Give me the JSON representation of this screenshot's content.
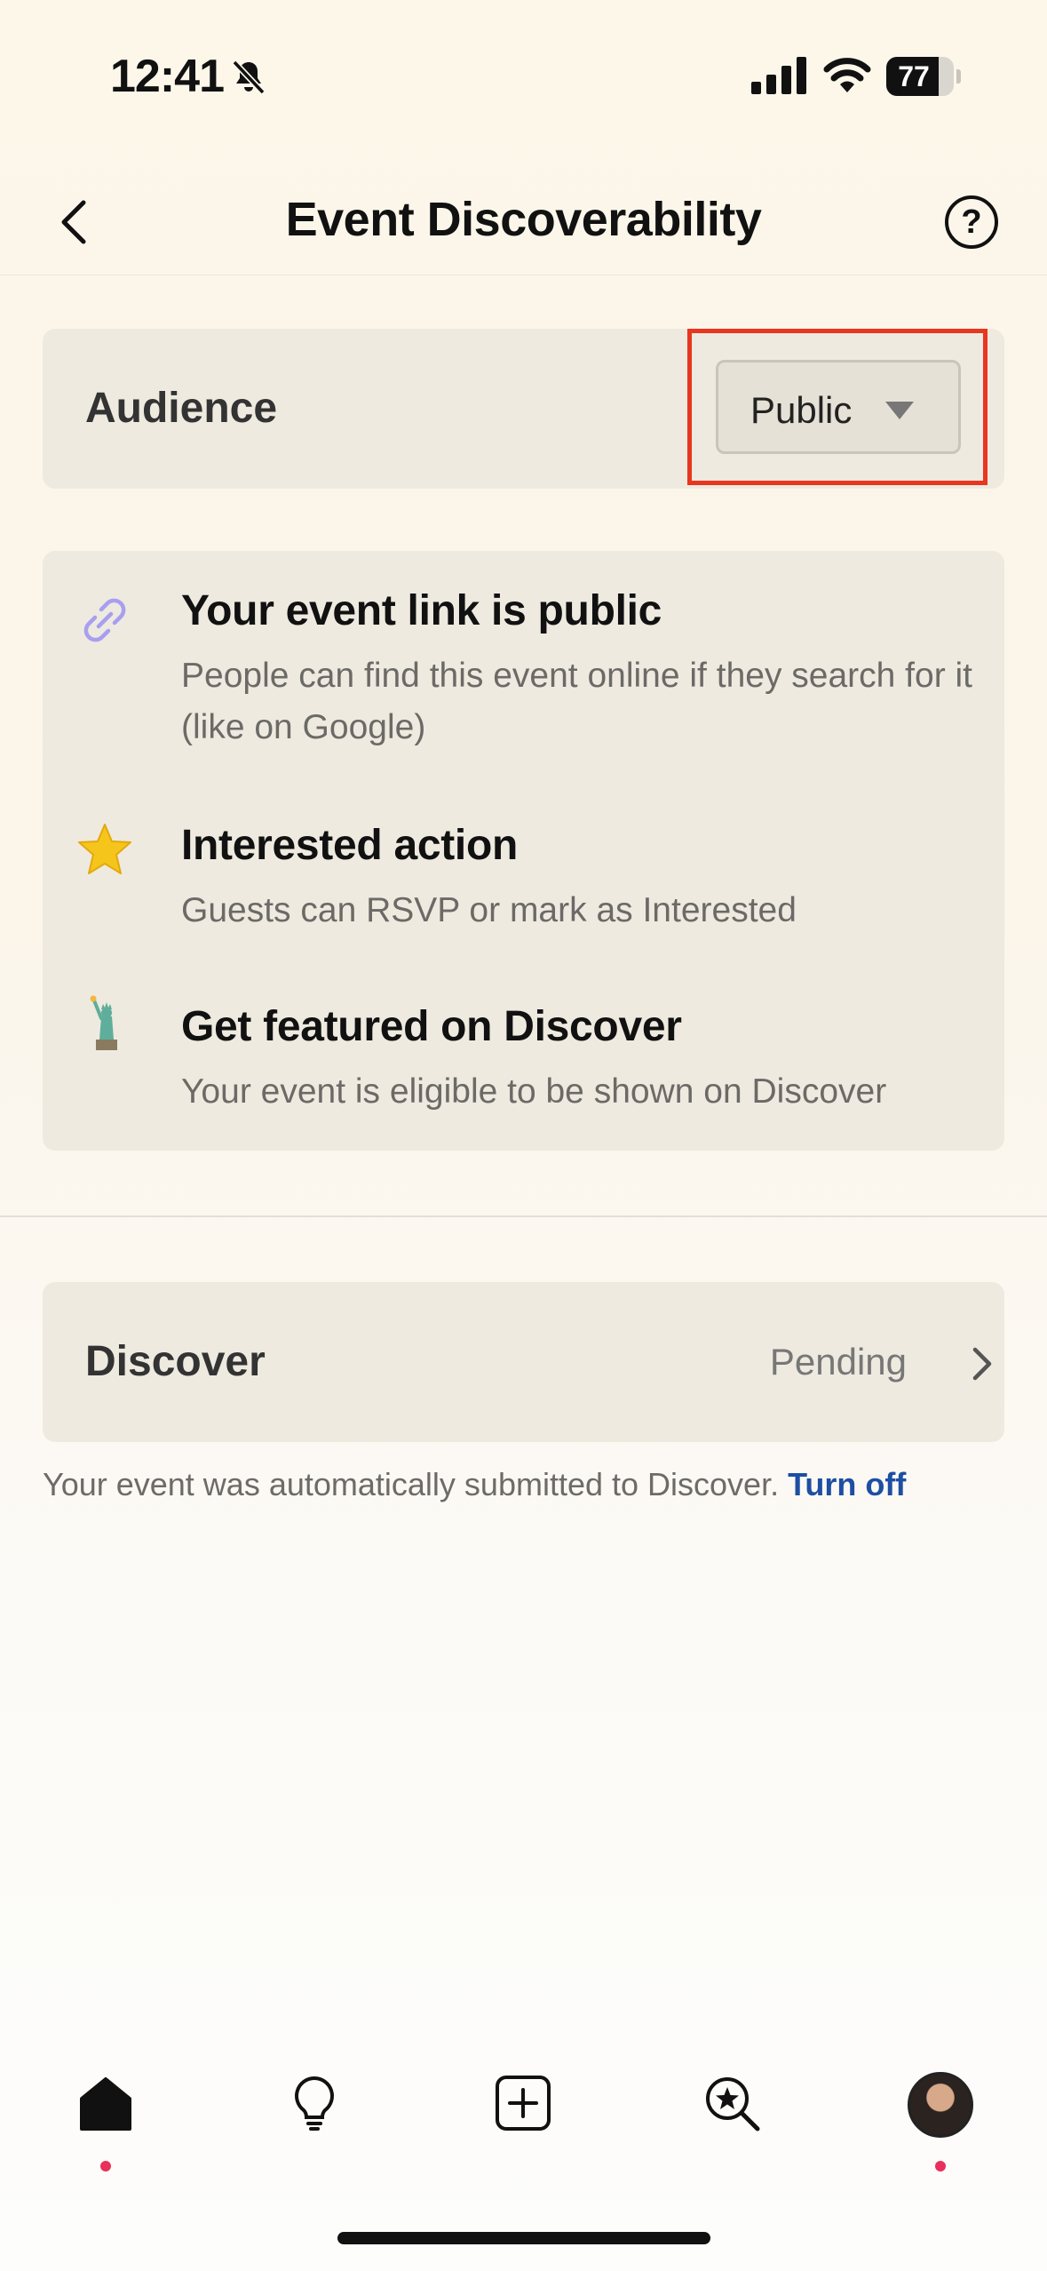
{
  "status_bar": {
    "time": "12:41",
    "battery": "77",
    "battery_level": 0.77
  },
  "header": {
    "title": "Event Discoverability",
    "back_icon": "chevron-left-icon",
    "help_label": "?"
  },
  "audience": {
    "label": "Audience",
    "selected": "Public"
  },
  "info_items": [
    {
      "icon": "link-icon",
      "title": "Your event link is public",
      "description": "People can find this event online if they search for it (like on Google)"
    },
    {
      "icon": "star-icon",
      "title": "Interested action",
      "description": "Guests can RSVP or mark as Interested"
    },
    {
      "icon": "statue-of-liberty-icon",
      "title": "Get featured on Discover",
      "description": "Your event is eligible to be shown on Discover"
    }
  ],
  "discover": {
    "label": "Discover",
    "status": "Pending"
  },
  "footnote": {
    "text": "Your event was automatically submitted to Discover.",
    "link": "Turn off"
  },
  "tabs": [
    {
      "name": "home",
      "icon": "home-icon",
      "dot": true
    },
    {
      "name": "ideas",
      "icon": "lightbulb-icon",
      "dot": false
    },
    {
      "name": "create",
      "icon": "plus-square-icon",
      "dot": false
    },
    {
      "name": "discover",
      "icon": "discover-search-icon",
      "dot": false
    },
    {
      "name": "profile",
      "icon": "avatar",
      "dot": true
    }
  ],
  "colors": {
    "accent_link": "#1d4fa3",
    "highlight": "#e8361f",
    "notification_dot": "#e8305a",
    "card": "#eeeae0"
  }
}
